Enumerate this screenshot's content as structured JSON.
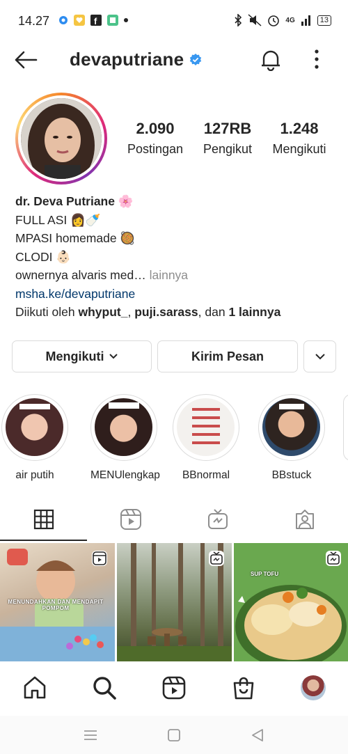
{
  "status_bar": {
    "time": "14.27",
    "network": "4G",
    "battery": "13"
  },
  "topbar": {
    "username": "devaputriane"
  },
  "stats": {
    "posts_value": "2.090",
    "posts_label": "Postingan",
    "followers_value": "127RB",
    "followers_label": "Pengikut",
    "following_value": "1.248",
    "following_label": "Mengikuti"
  },
  "bio": {
    "name": "dr. Deva Putriane 🌸",
    "line1": "FULL ASI 👩🍼",
    "line2": "MPASI homemade 🥘",
    "line3": "CLODI 👶🏻",
    "line4": "ownernya alvaris med…",
    "more": " lainnya",
    "link": "msha.ke/devaputriane",
    "followed_prefix": "Diikuti oleh ",
    "followed_user1": "whyput_",
    "followed_sep": ", ",
    "followed_user2": "puji.sarass",
    "followed_and": ", dan ",
    "followed_others": "1 lainnya"
  },
  "actions": {
    "follow_label": "Mengikuti",
    "message_label": "Kirim Pesan"
  },
  "highlights": [
    {
      "label": "air putih"
    },
    {
      "label": "MENUlengkap"
    },
    {
      "label": "BBnormal"
    },
    {
      "label": "BBstuck"
    }
  ],
  "posts": [
    {
      "caption": "MENUNDAHKAN DAN MENDAPIT POMPOM"
    },
    {
      "caption": ""
    },
    {
      "caption": "SUP TOFU"
    }
  ],
  "colors": {
    "link": "#00376b",
    "verified": "#3897f0",
    "border": "#dbdbdb",
    "muted": "#8e8e8e"
  }
}
